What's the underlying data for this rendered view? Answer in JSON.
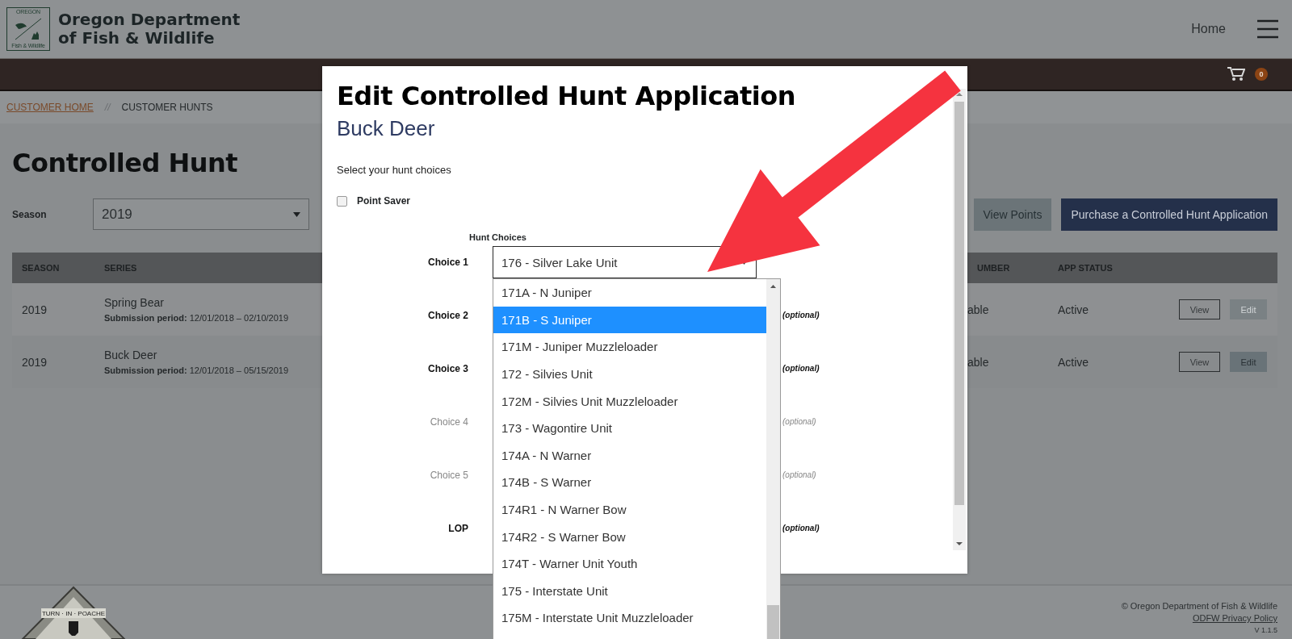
{
  "header": {
    "logo": {
      "top": "OREGON",
      "bottom": "Fish & Wildlife"
    },
    "title_lines": [
      "Oregon Department",
      "of Fish & Wildlife"
    ],
    "nav_link": "Home"
  },
  "cart": {
    "count": "0"
  },
  "breadcrumb": {
    "items": [
      {
        "label": "CUSTOMER HOME",
        "link": true
      },
      {
        "label": "CUSTOMER HUNTS",
        "link": false
      }
    ],
    "separator": "//"
  },
  "page": {
    "title": "Controlled Hunt",
    "season": {
      "label": "Season",
      "value": "2019"
    },
    "buttons": [
      {
        "label": "View Points",
        "kind": "secondary"
      },
      {
        "label": "Purchase a Controlled Hunt Application",
        "kind": "primary"
      }
    ]
  },
  "table": {
    "columns": [
      "SEASON",
      "SERIES",
      "UMBER",
      "APP STATUS"
    ],
    "rows": [
      {
        "season": "2019",
        "series": "Spring Bear",
        "period_label": "Submission period:",
        "period": "12/01/2018 – 02/10/2019",
        "column_3": "able",
        "status": "Active",
        "view": "View",
        "edit": {
          "label": "Edit",
          "disabled": true
        }
      },
      {
        "season": "2019",
        "series": "Buck Deer",
        "period_label": "Submission period:",
        "period": "12/01/2018 – 05/15/2019",
        "column_3": "able",
        "status": "Active",
        "view": "View",
        "edit": {
          "label": "Edit",
          "disabled": false
        }
      }
    ]
  },
  "modal": {
    "title": "Edit Controlled Hunt Application",
    "subtitle": "Buck Deer",
    "prompt": "Select your hunt choices",
    "point_saver": {
      "label": "Point Saver",
      "checked": false
    },
    "choices_heading": "Hunt Choices",
    "choices": [
      {
        "label": "Choice 1",
        "value": "176 - Silver Lake Unit",
        "disabled": false,
        "open": true,
        "options": [
          {
            "label": "171A - N Juniper",
            "selected": false
          },
          {
            "label": "171B - S Juniper",
            "selected": true
          },
          {
            "label": "171M - Juniper Muzzleloader",
            "selected": false
          },
          {
            "label": "172 - Silvies Unit",
            "selected": false
          },
          {
            "label": "172M - Silvies Unit Muzzleloader",
            "selected": false
          },
          {
            "label": "173 - Wagontire Unit",
            "selected": false
          },
          {
            "label": "174A - N Warner",
            "selected": false
          },
          {
            "label": "174B - S Warner",
            "selected": false
          },
          {
            "label": "174R1 - N Warner Bow",
            "selected": false
          },
          {
            "label": "174R2 - S Warner Bow",
            "selected": false
          },
          {
            "label": "174T - Warner Unit Youth",
            "selected": false
          },
          {
            "label": "175 - Interstate Unit",
            "selected": false
          },
          {
            "label": "175M - Interstate Unit Muzzleloader",
            "selected": false
          }
        ]
      },
      {
        "label": "Choice 2",
        "note": "(optional)",
        "disabled": false
      },
      {
        "label": "Choice 3",
        "note": "(optional)",
        "disabled": false
      },
      {
        "label": "Choice 4",
        "note": "(optional)",
        "disabled": true
      },
      {
        "label": "Choice 5",
        "note": "(optional)",
        "disabled": true
      },
      {
        "label": "LOP",
        "note": "(optional)",
        "disabled": false
      }
    ]
  },
  "footer": {
    "badge_text": "TURN · IN · POACHE",
    "copyright": "© Oregon Department of Fish & Wildlife",
    "privacy_link": "ODFW Privacy Policy",
    "version": "V 1.1.5"
  }
}
